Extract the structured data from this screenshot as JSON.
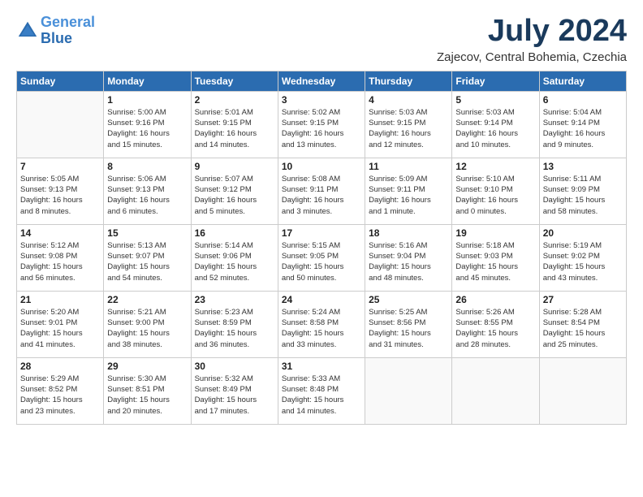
{
  "header": {
    "logo_line1": "General",
    "logo_line2": "Blue",
    "month": "July 2024",
    "location": "Zajecov, Central Bohemia, Czechia"
  },
  "days_of_week": [
    "Sunday",
    "Monday",
    "Tuesday",
    "Wednesday",
    "Thursday",
    "Friday",
    "Saturday"
  ],
  "weeks": [
    [
      {
        "day": "",
        "info": ""
      },
      {
        "day": "1",
        "info": "Sunrise: 5:00 AM\nSunset: 9:16 PM\nDaylight: 16 hours\nand 15 minutes."
      },
      {
        "day": "2",
        "info": "Sunrise: 5:01 AM\nSunset: 9:15 PM\nDaylight: 16 hours\nand 14 minutes."
      },
      {
        "day": "3",
        "info": "Sunrise: 5:02 AM\nSunset: 9:15 PM\nDaylight: 16 hours\nand 13 minutes."
      },
      {
        "day": "4",
        "info": "Sunrise: 5:03 AM\nSunset: 9:15 PM\nDaylight: 16 hours\nand 12 minutes."
      },
      {
        "day": "5",
        "info": "Sunrise: 5:03 AM\nSunset: 9:14 PM\nDaylight: 16 hours\nand 10 minutes."
      },
      {
        "day": "6",
        "info": "Sunrise: 5:04 AM\nSunset: 9:14 PM\nDaylight: 16 hours\nand 9 minutes."
      }
    ],
    [
      {
        "day": "7",
        "info": "Sunrise: 5:05 AM\nSunset: 9:13 PM\nDaylight: 16 hours\nand 8 minutes."
      },
      {
        "day": "8",
        "info": "Sunrise: 5:06 AM\nSunset: 9:13 PM\nDaylight: 16 hours\nand 6 minutes."
      },
      {
        "day": "9",
        "info": "Sunrise: 5:07 AM\nSunset: 9:12 PM\nDaylight: 16 hours\nand 5 minutes."
      },
      {
        "day": "10",
        "info": "Sunrise: 5:08 AM\nSunset: 9:11 PM\nDaylight: 16 hours\nand 3 minutes."
      },
      {
        "day": "11",
        "info": "Sunrise: 5:09 AM\nSunset: 9:11 PM\nDaylight: 16 hours\nand 1 minute."
      },
      {
        "day": "12",
        "info": "Sunrise: 5:10 AM\nSunset: 9:10 PM\nDaylight: 16 hours\nand 0 minutes."
      },
      {
        "day": "13",
        "info": "Sunrise: 5:11 AM\nSunset: 9:09 PM\nDaylight: 15 hours\nand 58 minutes."
      }
    ],
    [
      {
        "day": "14",
        "info": "Sunrise: 5:12 AM\nSunset: 9:08 PM\nDaylight: 15 hours\nand 56 minutes."
      },
      {
        "day": "15",
        "info": "Sunrise: 5:13 AM\nSunset: 9:07 PM\nDaylight: 15 hours\nand 54 minutes."
      },
      {
        "day": "16",
        "info": "Sunrise: 5:14 AM\nSunset: 9:06 PM\nDaylight: 15 hours\nand 52 minutes."
      },
      {
        "day": "17",
        "info": "Sunrise: 5:15 AM\nSunset: 9:05 PM\nDaylight: 15 hours\nand 50 minutes."
      },
      {
        "day": "18",
        "info": "Sunrise: 5:16 AM\nSunset: 9:04 PM\nDaylight: 15 hours\nand 48 minutes."
      },
      {
        "day": "19",
        "info": "Sunrise: 5:18 AM\nSunset: 9:03 PM\nDaylight: 15 hours\nand 45 minutes."
      },
      {
        "day": "20",
        "info": "Sunrise: 5:19 AM\nSunset: 9:02 PM\nDaylight: 15 hours\nand 43 minutes."
      }
    ],
    [
      {
        "day": "21",
        "info": "Sunrise: 5:20 AM\nSunset: 9:01 PM\nDaylight: 15 hours\nand 41 minutes."
      },
      {
        "day": "22",
        "info": "Sunrise: 5:21 AM\nSunset: 9:00 PM\nDaylight: 15 hours\nand 38 minutes."
      },
      {
        "day": "23",
        "info": "Sunrise: 5:23 AM\nSunset: 8:59 PM\nDaylight: 15 hours\nand 36 minutes."
      },
      {
        "day": "24",
        "info": "Sunrise: 5:24 AM\nSunset: 8:58 PM\nDaylight: 15 hours\nand 33 minutes."
      },
      {
        "day": "25",
        "info": "Sunrise: 5:25 AM\nSunset: 8:56 PM\nDaylight: 15 hours\nand 31 minutes."
      },
      {
        "day": "26",
        "info": "Sunrise: 5:26 AM\nSunset: 8:55 PM\nDaylight: 15 hours\nand 28 minutes."
      },
      {
        "day": "27",
        "info": "Sunrise: 5:28 AM\nSunset: 8:54 PM\nDaylight: 15 hours\nand 25 minutes."
      }
    ],
    [
      {
        "day": "28",
        "info": "Sunrise: 5:29 AM\nSunset: 8:52 PM\nDaylight: 15 hours\nand 23 minutes."
      },
      {
        "day": "29",
        "info": "Sunrise: 5:30 AM\nSunset: 8:51 PM\nDaylight: 15 hours\nand 20 minutes."
      },
      {
        "day": "30",
        "info": "Sunrise: 5:32 AM\nSunset: 8:49 PM\nDaylight: 15 hours\nand 17 minutes."
      },
      {
        "day": "31",
        "info": "Sunrise: 5:33 AM\nSunset: 8:48 PM\nDaylight: 15 hours\nand 14 minutes."
      },
      {
        "day": "",
        "info": ""
      },
      {
        "day": "",
        "info": ""
      },
      {
        "day": "",
        "info": ""
      }
    ]
  ]
}
